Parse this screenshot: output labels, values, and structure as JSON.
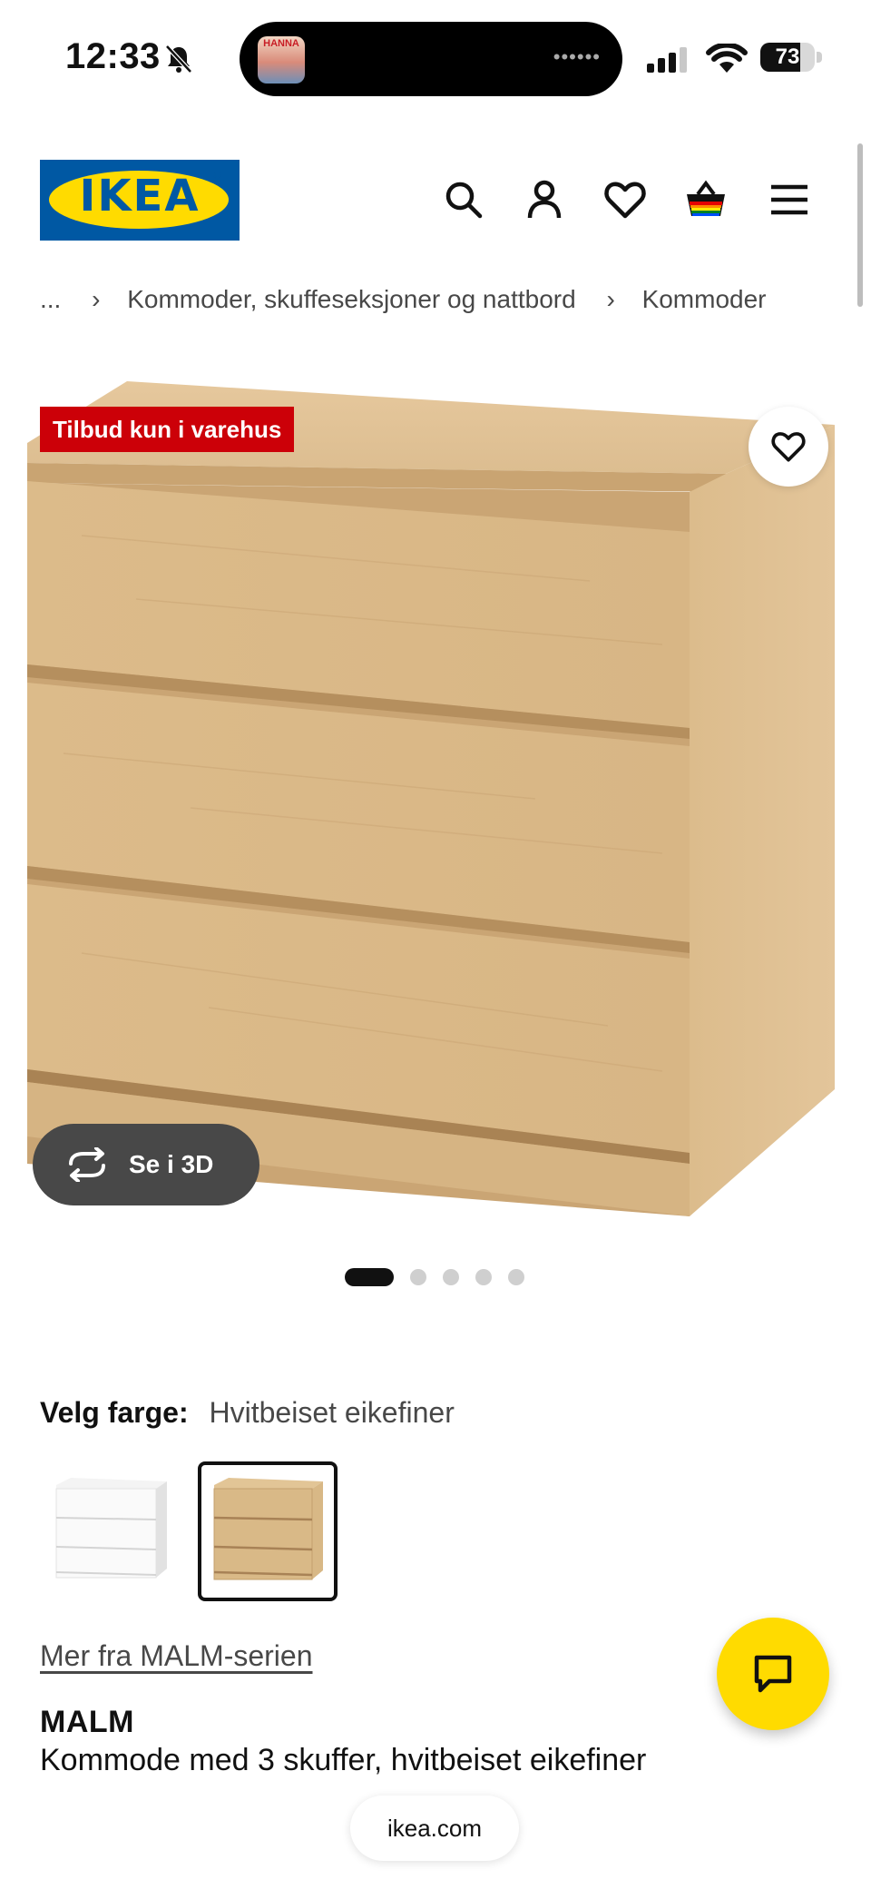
{
  "status_bar": {
    "time": "12:33",
    "battery": "73",
    "battery_level": 0.73,
    "island_avatar_text": "HANNA",
    "island_dots": "••••••"
  },
  "header": {
    "logo_text": "IKEA",
    "logo_reg": "®",
    "icons": [
      "search-icon",
      "account-icon",
      "wishlist-heart-icon",
      "cart-basket-icon",
      "menu-icon"
    ]
  },
  "breadcrumb": {
    "items": [
      "...",
      "Kommoder, skuffeseksjoner og nattbord",
      "Kommoder"
    ],
    "separator": "›"
  },
  "product_image": {
    "promo_badge": "Tilbud kun i varehus",
    "view_3d_label": "Se i 3D",
    "carousel_total": 5,
    "carousel_active": 1
  },
  "color_picker": {
    "label": "Velg farge:",
    "selected_value": "Hvitbeiset eikefiner",
    "swatches": [
      "white",
      "oak"
    ]
  },
  "series_link": "Mer fra MALM-serien",
  "product": {
    "name": "MALM",
    "description": "Kommode med 3 skuffer, hvitbeiset eikefiner"
  },
  "browser": {
    "url": "ikea.com"
  },
  "colors": {
    "ikea_blue": "#0058a3",
    "ikea_yellow": "#ffdb00",
    "promo_red": "#cc0008",
    "wood": "#d9b98a"
  }
}
